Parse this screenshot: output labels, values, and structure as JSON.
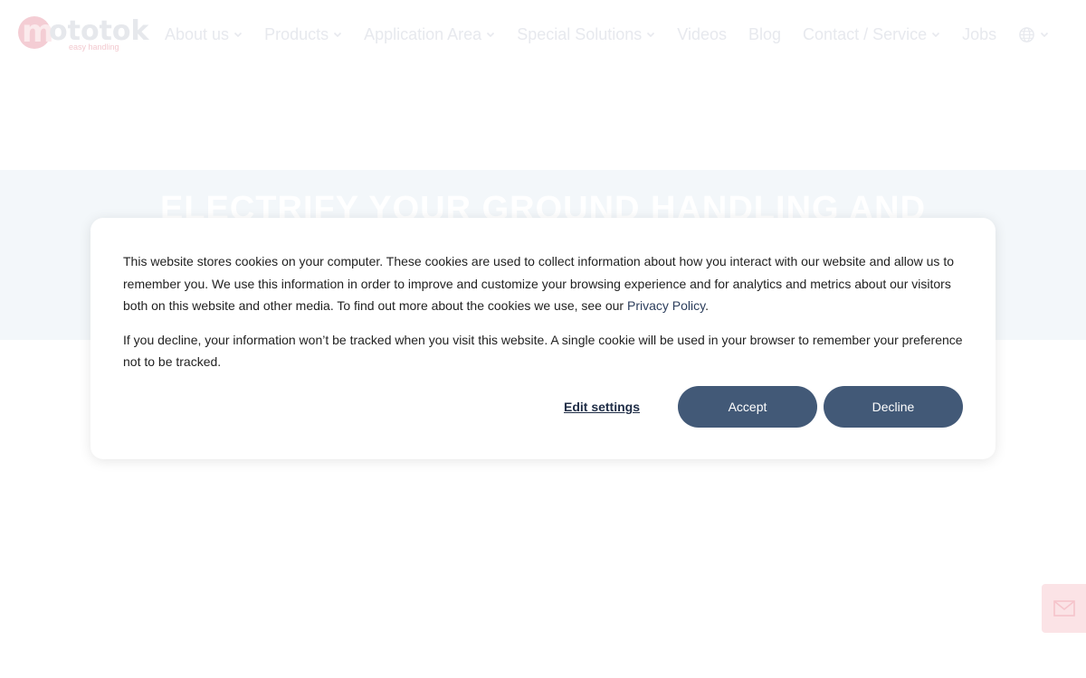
{
  "header": {
    "logo_letter": "m",
    "logo_text": "ototok",
    "logo_tagline": "easy handling",
    "nav": [
      {
        "label": "About us",
        "dropdown": true
      },
      {
        "label": "Products",
        "dropdown": true
      },
      {
        "label": "Application Area",
        "dropdown": true
      },
      {
        "label": "Special Solutions",
        "dropdown": true
      },
      {
        "label": "Videos",
        "dropdown": false
      },
      {
        "label": "Blog",
        "dropdown": false
      },
      {
        "label": "Contact / Service",
        "dropdown": true
      },
      {
        "label": "Jobs",
        "dropdown": false
      }
    ],
    "language_icon": "globe-icon"
  },
  "hero": {
    "title": "ELECTRIFY YOUR GROUND HANDLING AND"
  },
  "cookie": {
    "paragraph1": "This website stores cookies on your computer. These cookies are used to collect information about how you interact with our website and allow us to remember you. We use this information in order to improve and customize your browsing experience and for analytics and metrics about our visitors both on this website and other media. To find out more about the cookies we use, see our ",
    "privacy_link": "Privacy Policy",
    "paragraph1_end": ".",
    "paragraph2": "If you decline, your information won’t be tracked when you visit this website. A single cookie will be used in your browser to remember your preference not to be tracked.",
    "edit_settings": "Edit settings",
    "accept": "Accept",
    "decline": "Decline"
  },
  "floating": {
    "mail_icon": "mail-icon"
  },
  "colors": {
    "button": "#425977",
    "hero_band": "#f3f7fa",
    "brand_pink": "#e8475f"
  }
}
